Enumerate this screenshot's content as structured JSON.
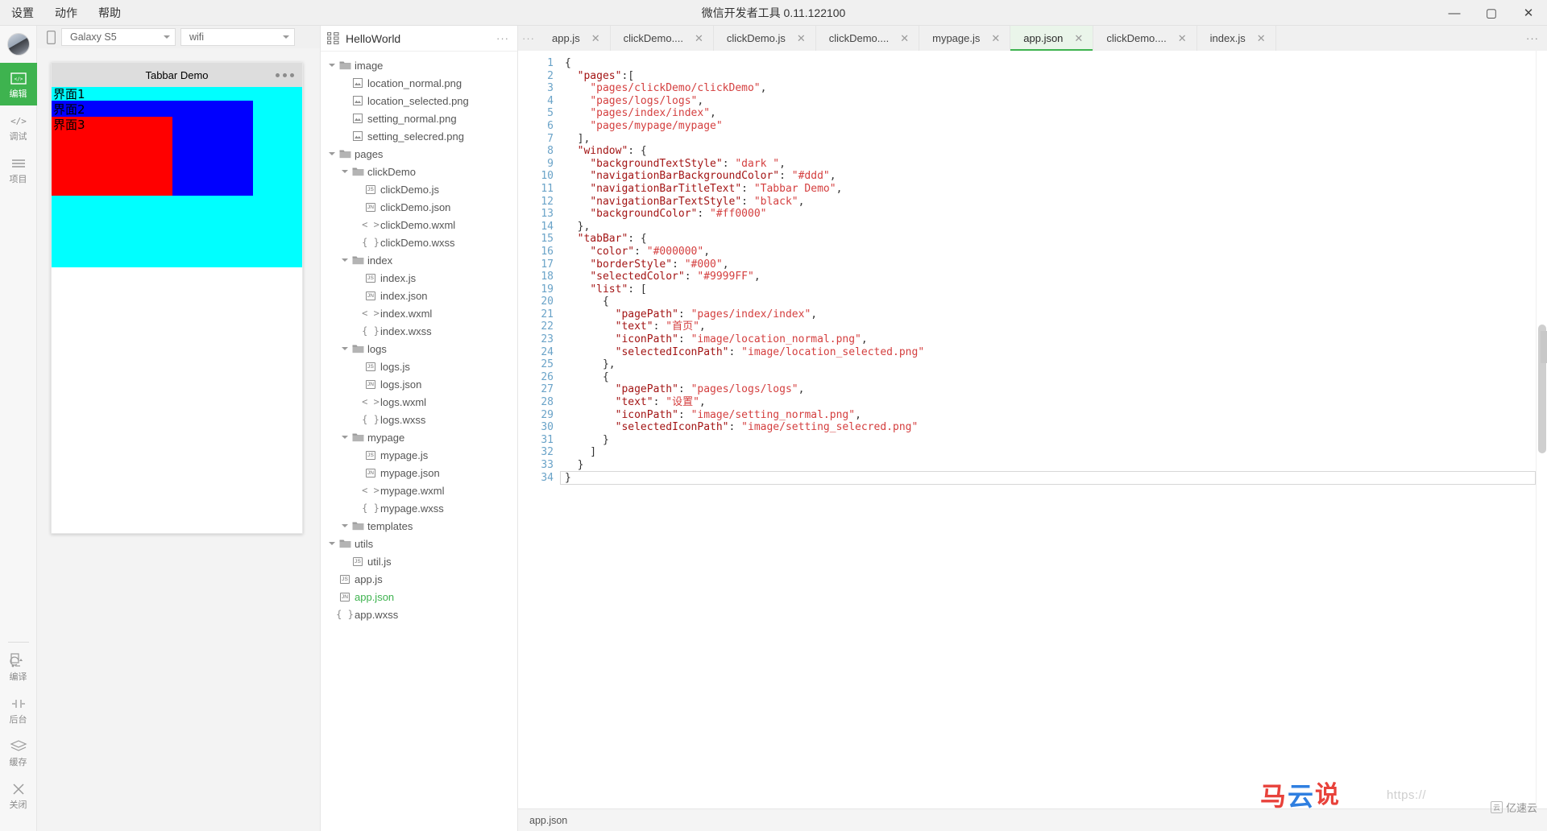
{
  "window": {
    "title": "微信开发者工具 0.11.122100",
    "minimize": "—",
    "maximize": "▢",
    "close": "✕"
  },
  "menu": [
    {
      "label": "设置"
    },
    {
      "label": "动作"
    },
    {
      "label": "帮助"
    }
  ],
  "rail": {
    "items": [
      {
        "label": "编辑",
        "icon": "code-box-icon",
        "active": true
      },
      {
        "label": "调试",
        "icon": "angle-brackets-icon",
        "active": false
      },
      {
        "label": "项目",
        "icon": "hamburger-icon",
        "active": false
      },
      {
        "label": "编译",
        "icon": "compile-refresh-icon",
        "active": false
      },
      {
        "label": "后台",
        "icon": "background-icon",
        "active": false
      },
      {
        "label": "缓存",
        "icon": "layers-icon",
        "active": false
      },
      {
        "label": "关闭",
        "icon": "close-x-icon",
        "active": false
      }
    ]
  },
  "simulator": {
    "device": "Galaxy S5",
    "network": "wifi",
    "device_icon": "phone-icon",
    "phone": {
      "nav_title": "Tabbar Demo",
      "nav_bg": "#dddddd",
      "screen_bg": "#00ffff",
      "labels": [
        "界面1",
        "界面2",
        "界面3"
      ],
      "blue_block": "#0000ff",
      "red_block": "#ff0000"
    }
  },
  "tree": {
    "project_icon": "project-tree-icon",
    "title": "HelloWorld",
    "more": "···",
    "nodes": [
      {
        "depth": 0,
        "type": "folder",
        "label": "image",
        "expanded": true
      },
      {
        "depth": 1,
        "type": "img",
        "label": "location_normal.png"
      },
      {
        "depth": 1,
        "type": "img",
        "label": "location_selected.png"
      },
      {
        "depth": 1,
        "type": "img",
        "label": "setting_normal.png"
      },
      {
        "depth": 1,
        "type": "img",
        "label": "setting_selecred.png"
      },
      {
        "depth": 0,
        "type": "folder",
        "label": "pages",
        "expanded": true
      },
      {
        "depth": 1,
        "type": "folder",
        "label": "clickDemo",
        "expanded": true
      },
      {
        "depth": 2,
        "type": "js",
        "label": "clickDemo.js"
      },
      {
        "depth": 2,
        "type": "json",
        "label": "clickDemo.json"
      },
      {
        "depth": 2,
        "type": "wxml",
        "label": "clickDemo.wxml"
      },
      {
        "depth": 2,
        "type": "wxss",
        "label": "clickDemo.wxss"
      },
      {
        "depth": 1,
        "type": "folder",
        "label": "index",
        "expanded": true
      },
      {
        "depth": 2,
        "type": "js",
        "label": "index.js"
      },
      {
        "depth": 2,
        "type": "json",
        "label": "index.json"
      },
      {
        "depth": 2,
        "type": "wxml",
        "label": "index.wxml"
      },
      {
        "depth": 2,
        "type": "wxss",
        "label": "index.wxss"
      },
      {
        "depth": 1,
        "type": "folder",
        "label": "logs",
        "expanded": true
      },
      {
        "depth": 2,
        "type": "js",
        "label": "logs.js"
      },
      {
        "depth": 2,
        "type": "json",
        "label": "logs.json"
      },
      {
        "depth": 2,
        "type": "wxml",
        "label": "logs.wxml"
      },
      {
        "depth": 2,
        "type": "wxss",
        "label": "logs.wxss"
      },
      {
        "depth": 1,
        "type": "folder",
        "label": "mypage",
        "expanded": true
      },
      {
        "depth": 2,
        "type": "js",
        "label": "mypage.js"
      },
      {
        "depth": 2,
        "type": "json",
        "label": "mypage.json"
      },
      {
        "depth": 2,
        "type": "wxml",
        "label": "mypage.wxml"
      },
      {
        "depth": 2,
        "type": "wxss",
        "label": "mypage.wxss"
      },
      {
        "depth": 1,
        "type": "folder",
        "label": "templates",
        "expanded": false
      },
      {
        "depth": 0,
        "type": "folder",
        "label": "utils",
        "expanded": true
      },
      {
        "depth": 1,
        "type": "js",
        "label": "util.js"
      },
      {
        "depth": 0,
        "type": "js",
        "label": "app.js"
      },
      {
        "depth": 0,
        "type": "json",
        "label": "app.json",
        "selected": true
      },
      {
        "depth": 0,
        "type": "wxss",
        "label": "app.wxss"
      }
    ]
  },
  "editor": {
    "overflow_icon": "···",
    "close_glyph": "✕",
    "tabs": [
      {
        "label": "app.js",
        "active": false
      },
      {
        "label": "clickDemo....",
        "active": false
      },
      {
        "label": "clickDemo.js",
        "active": false
      },
      {
        "label": "clickDemo....",
        "active": false
      },
      {
        "label": "mypage.js",
        "active": false
      },
      {
        "label": "app.json",
        "active": true
      },
      {
        "label": "clickDemo....",
        "active": false
      },
      {
        "label": "index.js",
        "active": false
      }
    ],
    "tabs_overflow_right": "···",
    "accent": "#3eb34f",
    "first_line_number": 1,
    "last_line_number": 34,
    "code_lines": [
      "{",
      "  \"pages\":[",
      "    \"pages/clickDemo/clickDemo\",",
      "    \"pages/logs/logs\",",
      "    \"pages/index/index\",",
      "    \"pages/mypage/mypage\"",
      "  ],",
      "  \"window\": {",
      "    \"backgroundTextStyle\": \"dark \",",
      "    \"navigationBarBackgroundColor\": \"#ddd\",",
      "    \"navigationBarTitleText\": \"Tabbar Demo\",",
      "    \"navigationBarTextStyle\": \"black\",",
      "    \"backgroundColor\": \"#ff0000\"",
      "  },",
      "  \"tabBar\": {",
      "    \"color\": \"#000000\",",
      "    \"borderStyle\": \"#000\",",
      "    \"selectedColor\": \"#9999FF\",",
      "    \"list\": [",
      "      {",
      "        \"pagePath\": \"pages/index/index\",",
      "        \"text\": \"首页\",",
      "        \"iconPath\": \"image/location_normal.png\",",
      "        \"selectedIconPath\": \"image/location_selected.png\"",
      "      },",
      "      {",
      "        \"pagePath\": \"pages/logs/logs\",",
      "        \"text\": \"设置\",",
      "        \"iconPath\": \"image/setting_normal.png\",",
      "        \"selectedIconPath\": \"image/setting_selecred.png\"",
      "      }",
      "    ]",
      "  }",
      "}"
    ]
  },
  "status": {
    "file": "app.json"
  },
  "watermark": {
    "url": "https://",
    "cn": [
      "马",
      "云",
      "说"
    ],
    "badge": "亿速云"
  }
}
